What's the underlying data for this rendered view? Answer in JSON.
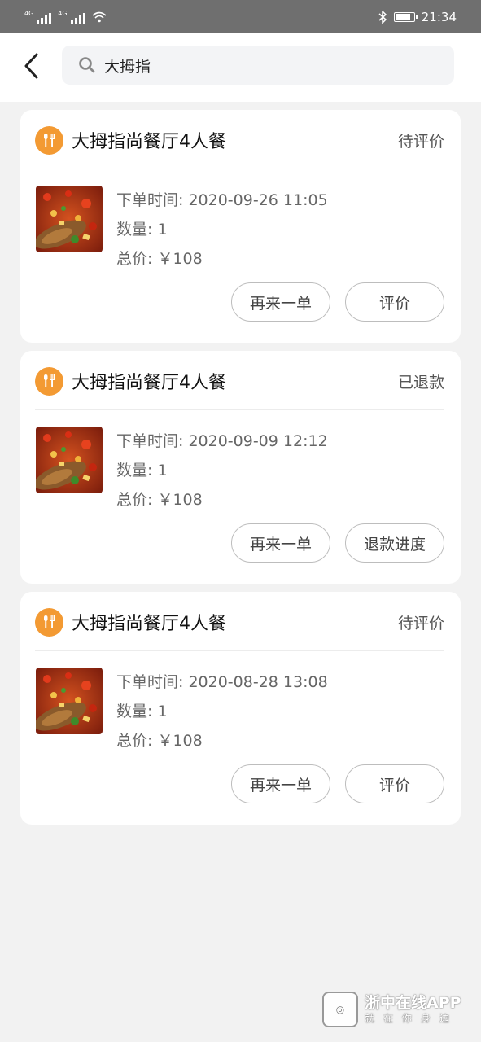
{
  "status_bar": {
    "sig1": "4G",
    "sig2": "4G",
    "time": "21:34",
    "battery_level": 0.85
  },
  "search": {
    "query": "大拇指"
  },
  "orders": [
    {
      "shop_name": "大拇指尚餐厅4人餐",
      "status": "待评价",
      "time": "下单时间: 2020-09-26 11:05",
      "quantity": "数量: 1",
      "price": "总价: ￥108",
      "btn_reorder": "再来一单",
      "btn_second": "评价"
    },
    {
      "shop_name": "大拇指尚餐厅4人餐",
      "status": "已退款",
      "time": "下单时间: 2020-09-09 12:12",
      "quantity": "数量: 1",
      "price": "总价: ￥108",
      "btn_reorder": "再来一单",
      "btn_second": "退款进度"
    },
    {
      "shop_name": "大拇指尚餐厅4人餐",
      "status": "待评价",
      "time": "下单时间: 2020-08-28 13:08",
      "quantity": "数量: 1",
      "price": "总价: ￥108",
      "btn_reorder": "再来一单",
      "btn_second": "评价"
    }
  ],
  "watermark": {
    "title": "浙中在线APP",
    "subtitle": "就在你身边"
  },
  "icons": {
    "back": "back-arrow-icon",
    "search": "search-icon",
    "shop": "restaurant-icon"
  },
  "colors": {
    "accent": "#f39a33",
    "status_bar": "#6f6f6f",
    "background": "#f2f2f2"
  }
}
